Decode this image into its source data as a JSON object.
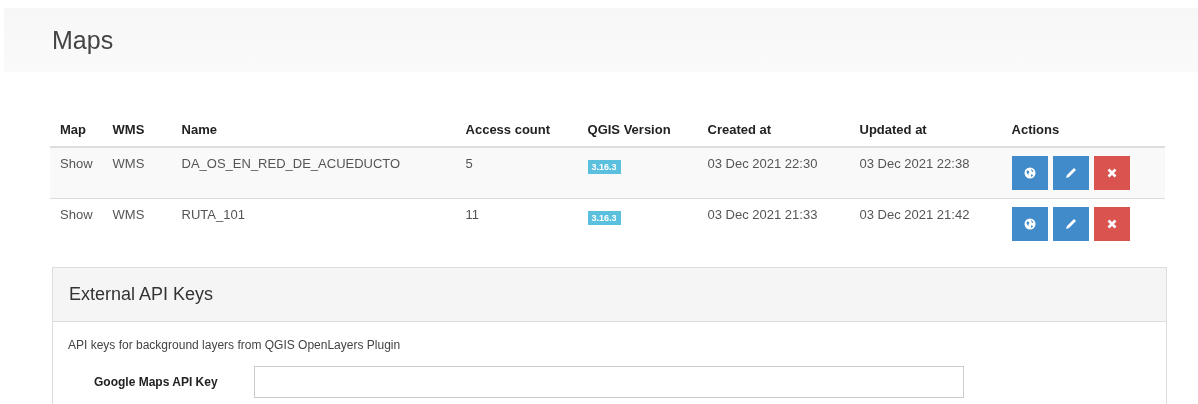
{
  "page": {
    "title": "Maps"
  },
  "table": {
    "columns": [
      "Map",
      "WMS",
      "Name",
      "Access count",
      "QGIS Version",
      "Created at",
      "Updated at",
      "Actions"
    ],
    "rows": [
      {
        "map": "Show",
        "wms": "WMS",
        "name": "DA_OS_EN_RED_DE_ACUEDUCTO",
        "access_count": "5",
        "qgis_version": "3.16.3",
        "created_at": "03 Dec 2021 22:30",
        "updated_at": "03 Dec 2021 22:38"
      },
      {
        "map": "Show",
        "wms": "WMS",
        "name": "RUTA_101",
        "access_count": "11",
        "qgis_version": "3.16.3",
        "created_at": "03 Dec 2021 21:33",
        "updated_at": "03 Dec 2021 21:42"
      }
    ]
  },
  "api_keys_panel": {
    "title": "External API Keys",
    "description": "API keys for background layers from QGIS OpenLayers Plugin",
    "fields": [
      {
        "label": "Google Maps API Key"
      }
    ]
  }
}
